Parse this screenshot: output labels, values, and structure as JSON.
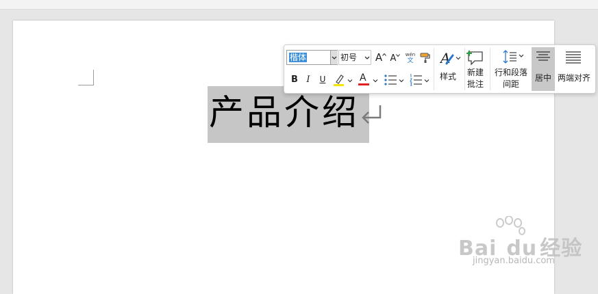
{
  "document": {
    "title_text": "产品介绍"
  },
  "toolbar": {
    "font_name": "楷体",
    "font_size": "初号",
    "grow_font_label": "A",
    "shrink_font_label": "A",
    "phonetic_top": "wén",
    "phonetic_bottom": "文",
    "bold_label": "B",
    "italic_label": "I",
    "underline_label": "U",
    "font_color_label": "A",
    "styles_label": "样式",
    "new_comment_line1": "新建",
    "new_comment_line2": "批注",
    "spacing_line1": "行和段落",
    "spacing_line2": "间距",
    "center_label": "居中",
    "justify_label": "两端对齐",
    "highlight_color": "#f5e600",
    "font_color": "#e02020",
    "selected_bg": "#3c8fd8"
  },
  "watermark": {
    "brand": "Bai",
    "brand2": "du",
    "brand3": "经验",
    "url": "jingyan.baidu.com"
  }
}
